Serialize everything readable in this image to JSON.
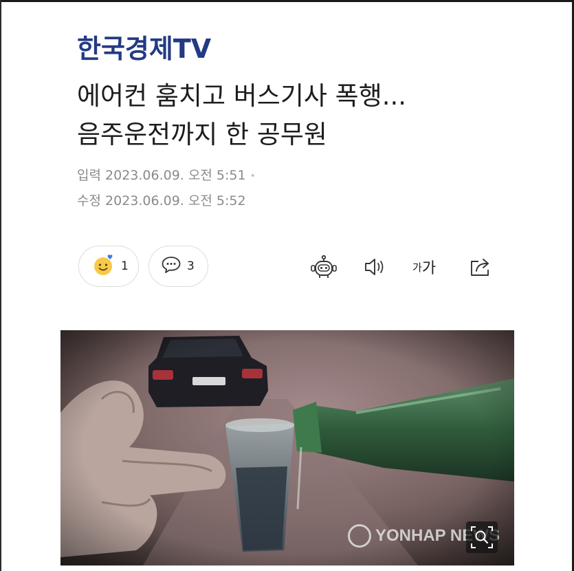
{
  "header": {
    "brand": "한국경제TV"
  },
  "article": {
    "title_line1": "에어컨 훔치고 버스기사 폭행...",
    "title_line2": "음주운전까지 한 공무원",
    "published_label": "입력",
    "published_value": "2023.06.09. 오전 5:51",
    "modified_label": "수정",
    "modified_value": "2023.06.09. 오전 5:52"
  },
  "actions": {
    "reaction_count": "1",
    "comment_count": "3",
    "font_small_label": "가",
    "font_big_label": "가"
  },
  "image": {
    "watermark_text": "YONHAP NEWS"
  },
  "colors": {
    "brand": "#233a84",
    "title": "#1d1d1d",
    "meta": "#8a8a8a"
  },
  "icons": [
    "smile-reaction-icon",
    "speech-bubble-icon",
    "robot-summary-icon",
    "speaker-icon",
    "share-icon",
    "zoom-icon"
  ]
}
